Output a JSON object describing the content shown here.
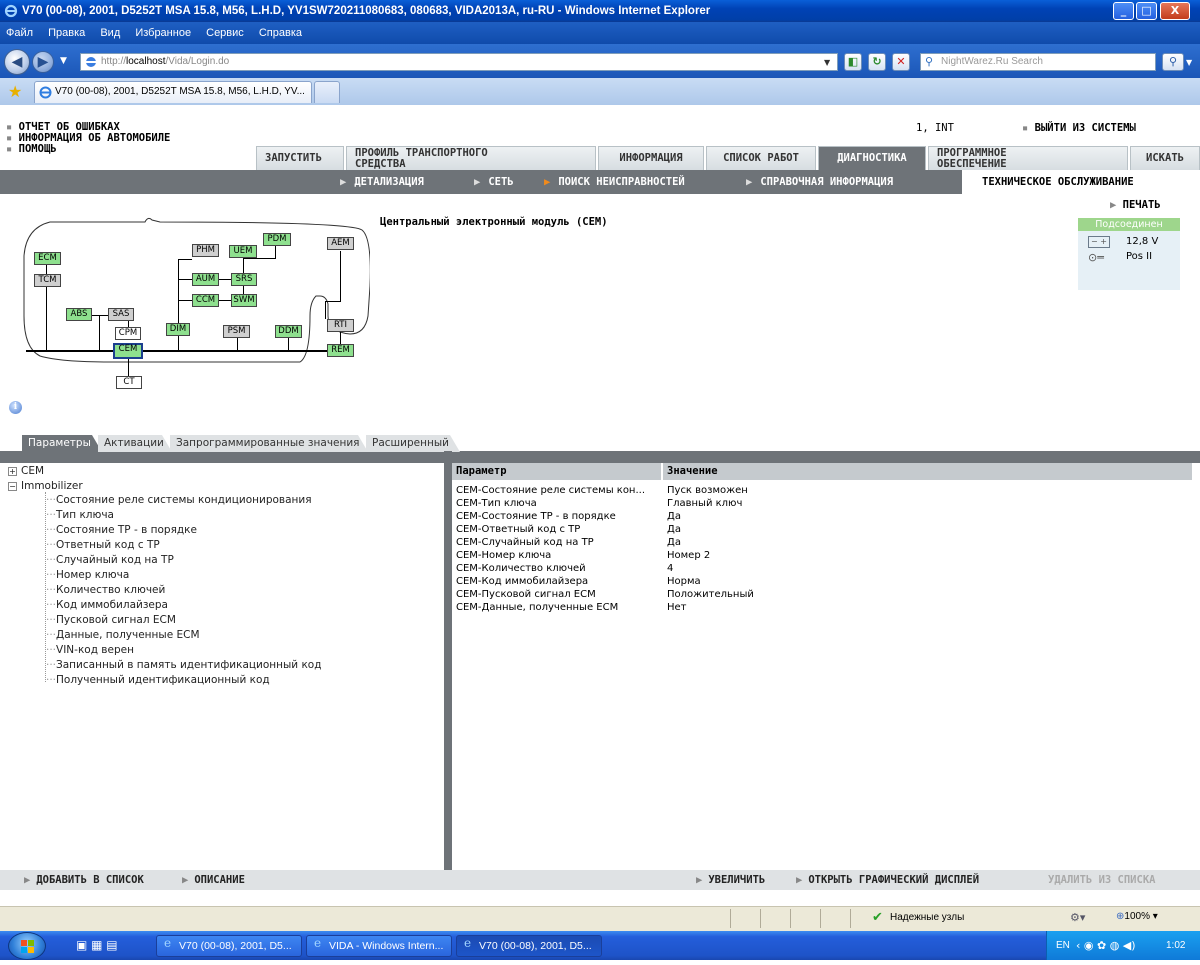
{
  "window": {
    "title": "V70 (00-08), 2001, D5252T MSA 15.8, M56, L.H.D, YV1SW720211080683, 080683, VIDA2013A, ru-RU - Windows Internet Explorer",
    "minimize": "_",
    "maximize": "□",
    "close": "X"
  },
  "menu": [
    "Файл",
    "Правка",
    "Вид",
    "Избранное",
    "Сервис",
    "Справка"
  ],
  "address": {
    "prefix": "http://",
    "host": "localhost",
    "path": "/Vida/Login.do",
    "search_placeholder": "NightWarez.Ru Search"
  },
  "browser_tab": {
    "label": "V70 (00-08), 2001, D5252T MSA 15.8, M56, L.H.D, YV..."
  },
  "app": {
    "left_links": [
      "ОТЧЕТ ОБ ОШИБКАХ",
      "ИНФОРМАЦИЯ ОБ АВТОМОБИЛЕ",
      "ПОМОЩЬ"
    ],
    "user": "1, INT",
    "logout": "ВЫЙТИ ИЗ СИСТЕМЫ",
    "tabs": [
      "ЗАПУСТИТЬ",
      "ПРОФИЛЬ ТРАНСПОРТНОГО СРЕДСТВА",
      "ИНФОРМАЦИЯ",
      "СПИСОК РАБОТ",
      "ДИАГНОСТИКА",
      "ПРОГРАММНОЕ ОБЕСПЕЧЕНИЕ",
      "ИСКАТЬ"
    ],
    "subtabs": [
      "ДЕТАЛИЗАЦИЯ",
      "СЕТЬ",
      "ПОИСК НЕИСПРАВНОСТЕЙ",
      "СПРАВОЧНАЯ ИНФОРМАЦИЯ"
    ],
    "subtab_active": "ТЕХНИЧЕСКОЕ ОБСЛУЖИВАНИЕ",
    "print": "ПЕЧАТЬ",
    "module_title": "Центральный электронный модуль (CEM)",
    "status": {
      "header": "Подсоединен",
      "voltage": "12,8 V",
      "key_position": "Pos II"
    },
    "diagram_nodes": [
      "ECM",
      "TCM",
      "PHM",
      "UEM",
      "PDM",
      "AEM",
      "AUM",
      "SRS",
      "CCM",
      "SWM",
      "ABS",
      "SAS",
      "CPM",
      "CEM",
      "DIM",
      "PSM",
      "DDM",
      "RTI",
      "REM",
      "CT"
    ],
    "panel_tabs": [
      "Параметры",
      "Активации",
      "Запрограммированные значения",
      "Расширенный"
    ],
    "tree": {
      "root1": "CEM",
      "root2": "Immobilizer",
      "children": [
        "Состояние реле системы кондиционирования",
        "Тип ключа",
        "Состояние ТР - в порядке",
        "Ответный код с ТР",
        "Случайный код на ТР",
        "Номер ключа",
        "Количество ключей",
        "Код иммобилайзера",
        "Пусковой сигнал ECM",
        "Данные, полученные ECM",
        "VIN-код верен",
        "Записанный в память идентификационный код",
        "Полученный идентификационный код"
      ]
    },
    "table": {
      "headers": [
        "Параметр",
        "Значение"
      ],
      "rows": [
        [
          "CEM-Состояние реле системы кон...",
          "Пуск возможен"
        ],
        [
          "CEM-Тип ключа",
          "Главный ключ"
        ],
        [
          "CEM-Состояние ТР - в порядке",
          "Да"
        ],
        [
          "CEM-Ответный код с ТР",
          "Да"
        ],
        [
          "CEM-Случайный код на ТР",
          "Да"
        ],
        [
          "CEM-Номер ключа",
          "Номер 2"
        ],
        [
          "CEM-Количество ключей",
          "4"
        ],
        [
          "CEM-Код иммобилайзера",
          "Норма"
        ],
        [
          "CEM-Пусковой сигнал ECM",
          "Положительный"
        ],
        [
          "CEM-Данные, полученные ECM",
          "Нет"
        ]
      ]
    },
    "footer": {
      "add_to_list": "ДОБАВИТЬ В СПИСОК",
      "description": "ОПИСАНИЕ",
      "zoom": "УВЕЛИЧИТЬ",
      "open_graph": "ОТКРЫТЬ ГРАФИЧЕСКИЙ ДИСПЛЕЙ",
      "remove": "УДАЛИТЬ ИЗ СПИСКА"
    }
  },
  "statusbar": {
    "zone": "Надежные узлы",
    "zoom": "100%"
  },
  "taskbar": {
    "items": [
      "V70 (00-08), 2001, D5...",
      "VIDA - Windows Intern...",
      "V70 (00-08), 2001, D5..."
    ],
    "lang": "EN",
    "clock": "1:02"
  },
  "colors": {
    "accent_bar": "#6e7378",
    "node_green": "#8ee08e",
    "node_gray": "#cfcfcf",
    "status_box": "#e6f0f6",
    "status_header": "#9ed68c",
    "xp_blue": "#245edb"
  }
}
